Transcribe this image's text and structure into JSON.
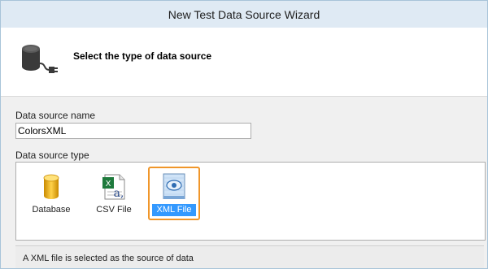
{
  "window": {
    "title": "New Test Data Source Wizard"
  },
  "header": {
    "text": "Select the type of data source",
    "icon": "database-plug-icon"
  },
  "data_source_name": {
    "label": "Data source name",
    "value": "ColorsXML"
  },
  "data_source_type": {
    "label": "Data source type",
    "selected": "XML File",
    "options": [
      {
        "label": "Database",
        "icon": "database-icon"
      },
      {
        "label": "CSV File",
        "icon": "csv-file-icon"
      },
      {
        "label": "XML File",
        "icon": "xml-file-icon"
      }
    ]
  },
  "status": {
    "text": "A XML file is selected as the source of data"
  },
  "colors": {
    "selection": "#3399ff",
    "highlight_border": "#f0962a",
    "titlebar": "#dfeaf4"
  }
}
